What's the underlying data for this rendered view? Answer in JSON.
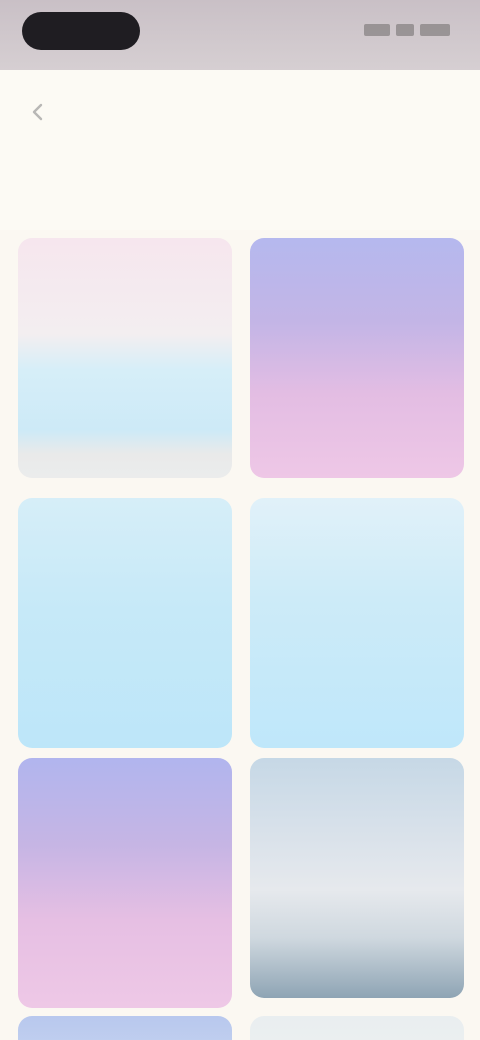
{
  "status_bar": {
    "time": ""
  },
  "header": {
    "title": "",
    "subtitle": ""
  },
  "cards": [
    {
      "title": "",
      "subtitle": "",
      "colors": [
        "#f6e6ee",
        "#cdeaf7"
      ]
    },
    {
      "title": "",
      "subtitle": "",
      "colors": [
        "#b5b8ee",
        "#eec7e6"
      ]
    },
    {
      "title": "",
      "subtitle": "",
      "colors": [
        "#d6eef8",
        "#bde6f9"
      ]
    },
    {
      "title": "",
      "subtitle": "",
      "colors": [
        "#e1f1f9",
        "#bfe7fa"
      ]
    },
    {
      "title": "",
      "subtitle": "",
      "colors": [
        "#b1b5ee",
        "#eec8e6"
      ]
    },
    {
      "title": "",
      "subtitle": "",
      "colors": [
        "#c6d8e6",
        "#8ea4b4"
      ]
    },
    {
      "title": "",
      "subtitle": "",
      "colors": [
        "#b8c8ee",
        "#c9d6f0"
      ]
    },
    {
      "title": "",
      "subtitle": "",
      "colors": [
        "#e9eef0",
        "#eef1f1"
      ]
    }
  ],
  "icons": {
    "back": "chevron-left-icon",
    "signal": "signal-icon",
    "wifi": "wifi-icon",
    "battery": "battery-icon"
  }
}
